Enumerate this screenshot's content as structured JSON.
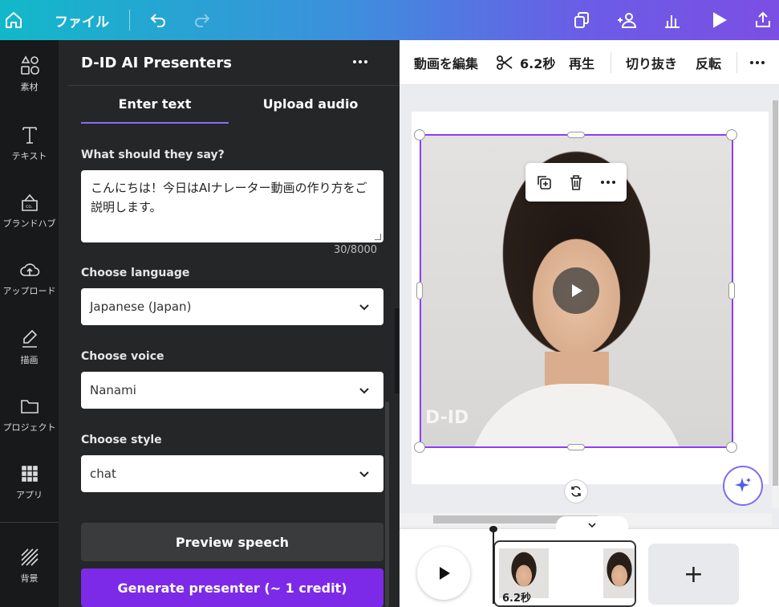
{
  "topbar": {
    "file_label": "ファイル",
    "icons": [
      "home-icon",
      "undo-icon",
      "redo-icon",
      "resize-icon",
      "share-people-icon",
      "insights-icon",
      "present-icon",
      "upload-icon"
    ]
  },
  "rail": {
    "items": [
      {
        "label": "素材",
        "icon": "elements-icon"
      },
      {
        "label": "テキスト",
        "icon": "text-icon"
      },
      {
        "label": "ブランドハブ",
        "icon": "brand-hub-icon"
      },
      {
        "label": "アップロード",
        "icon": "upload-cloud-icon"
      },
      {
        "label": "描画",
        "icon": "draw-icon"
      },
      {
        "label": "プロジェクト",
        "icon": "folder-icon"
      },
      {
        "label": "アプリ",
        "icon": "apps-grid-icon"
      },
      {
        "label": "背景",
        "icon": "background-icon"
      }
    ]
  },
  "panel": {
    "title": "D-ID AI Presenters",
    "tabs": [
      {
        "label": "Enter text"
      },
      {
        "label": "Upload audio"
      }
    ],
    "active_tab": "Enter text",
    "say_label": "What should they say?",
    "say_value": "こんにちは！今日はAIナレーター動画の作り方をご説明します。",
    "counter": "30/8000",
    "language_label": "Choose language",
    "language_value": "Japanese (Japan)",
    "voice_label": "Choose voice",
    "voice_value": "Nanami",
    "style_label": "Choose style",
    "style_value": "chat",
    "preview_button": "Preview speech",
    "generate_button": "Generate presenter (~ 1 credit)"
  },
  "toolbar": {
    "edit_video": "動画を編集",
    "duration": "6.2秒",
    "play": "再生",
    "crop": "切り抜き",
    "flip": "反転"
  },
  "canvas": {
    "watermark": "D-ID"
  },
  "timeline": {
    "clip_duration": "6.2秒",
    "add_page": "+"
  },
  "colors": {
    "accent": "#7d2ae8",
    "selection": "#8b3dff",
    "panel_bg": "#252627",
    "rail_bg": "#18191b"
  }
}
